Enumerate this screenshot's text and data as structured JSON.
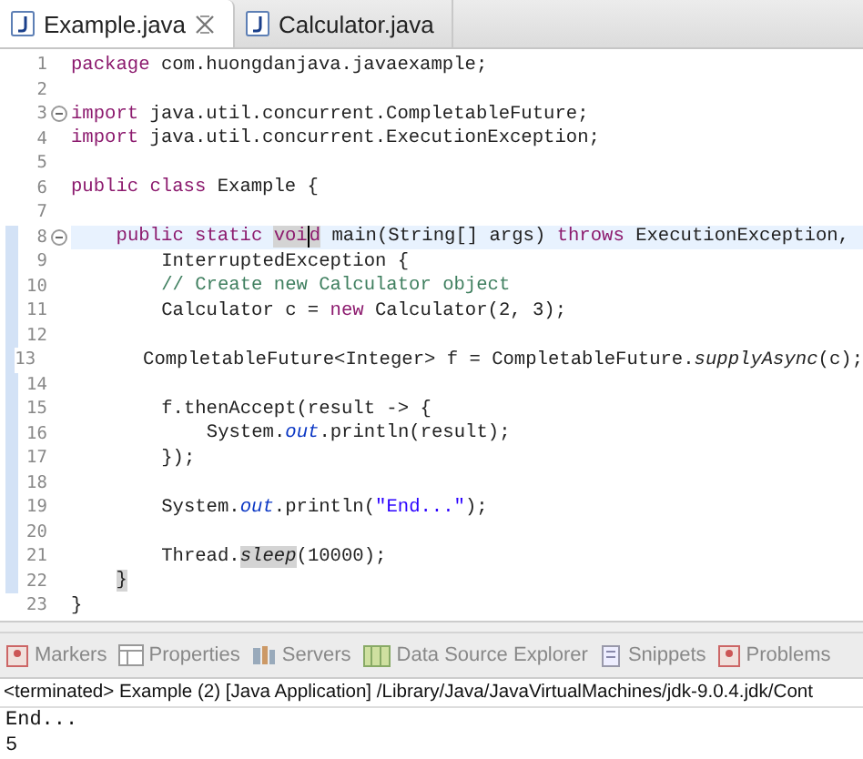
{
  "editor_tabs": [
    {
      "label": "Example.java",
      "selected": true,
      "closable": true
    },
    {
      "label": "Calculator.java",
      "selected": false,
      "closable": false
    }
  ],
  "code_lines": [
    {
      "number": "1",
      "kind": "top",
      "current": false,
      "in_range": false,
      "fold": false,
      "segments": [
        {
          "kind": "keyword",
          "text": "package ",
          "highlighted": false
        },
        {
          "kind": "plain",
          "text": "com.huongdanjava.javaexample;",
          "highlighted": false
        }
      ]
    },
    {
      "number": "2",
      "kind": "top",
      "current": false,
      "in_range": false,
      "fold": false
    },
    {
      "number": "3",
      "kind": "top",
      "current": false,
      "in_range": false,
      "fold": true,
      "segments": [
        {
          "kind": "keyword",
          "text": "import ",
          "highlighted": false
        },
        {
          "kind": "plain",
          "text": "java.util.concurrent.CompletableFuture;",
          "highlighted": false
        }
      ]
    },
    {
      "number": "4",
      "kind": "top",
      "current": false,
      "in_range": false,
      "fold": false,
      "segments": [
        {
          "kind": "keyword",
          "text": "import ",
          "highlighted": false
        },
        {
          "kind": "plain",
          "text": "java.util.concurrent.ExecutionException;",
          "highlighted": false
        }
      ]
    },
    {
      "number": "5",
      "kind": "top",
      "current": false,
      "in_range": false,
      "fold": false
    },
    {
      "number": "6",
      "kind": "top",
      "current": false,
      "in_range": false,
      "fold": false,
      "segments": [
        {
          "kind": "keyword",
          "text": "public class ",
          "highlighted": false
        },
        {
          "kind": "plain",
          "text": "Example {",
          "highlighted": false
        }
      ]
    },
    {
      "number": "7",
      "kind": "top",
      "current": false,
      "in_range": false,
      "fold": false
    },
    {
      "number": "8",
      "kind": "member",
      "current": true,
      "in_range": true,
      "fold": true,
      "segments": [
        {
          "kind": "keyword",
          "text": "public static ",
          "highlighted": false
        },
        {
          "kind": "keyword",
          "text": "voi",
          "highlighted": true
        },
        {
          "kind": "cursor"
        },
        {
          "kind": "keyword",
          "text": "d",
          "highlighted": true
        },
        {
          "kind": "plain",
          "text": " main(String[] args) ",
          "highlighted": false
        },
        {
          "kind": "keyword",
          "text": "throws ",
          "highlighted": false
        },
        {
          "kind": "plain",
          "text": "ExecutionException,",
          "highlighted": false
        }
      ]
    },
    {
      "number": "9",
      "kind": "body",
      "current": false,
      "in_range": true,
      "fold": false,
      "segments": [
        {
          "kind": "plain",
          "text": "InterruptedException {",
          "highlighted": false
        }
      ]
    },
    {
      "number": "10",
      "kind": "body",
      "current": false,
      "in_range": true,
      "fold": false,
      "segments": [
        {
          "kind": "comment",
          "text": "// Create new Calculator object",
          "highlighted": false
        }
      ]
    },
    {
      "number": "11",
      "kind": "body",
      "current": false,
      "in_range": true,
      "fold": false,
      "segments": [
        {
          "kind": "plain",
          "text": "Calculator c = ",
          "highlighted": false
        },
        {
          "kind": "keyword",
          "text": "new ",
          "highlighted": false
        },
        {
          "kind": "plain",
          "text": "Calculator(2, 3);",
          "highlighted": false
        }
      ]
    },
    {
      "number": "12",
      "kind": "body",
      "current": false,
      "in_range": true,
      "fold": false
    },
    {
      "number": "13",
      "kind": "body",
      "current": false,
      "in_range": true,
      "fold": false,
      "segments": [
        {
          "kind": "plain",
          "text": "CompletableFuture<Integer> f = CompletableFuture.",
          "highlighted": false
        },
        {
          "kind": "static",
          "text": "supplyAsync",
          "highlighted": false
        },
        {
          "kind": "plain",
          "text": "(c);",
          "highlighted": false
        }
      ]
    },
    {
      "number": "14",
      "kind": "body",
      "current": false,
      "in_range": true,
      "fold": false
    },
    {
      "number": "15",
      "kind": "body",
      "current": false,
      "in_range": true,
      "fold": false,
      "segments": [
        {
          "kind": "plain",
          "text": "f.thenAccept(result -> {",
          "highlighted": false
        }
      ]
    },
    {
      "number": "16",
      "kind": "inner",
      "current": false,
      "in_range": true,
      "fold": false,
      "segments": [
        {
          "kind": "plain",
          "text": "System.",
          "highlighted": false
        },
        {
          "kind": "field",
          "text": "out",
          "highlighted": false
        },
        {
          "kind": "plain",
          "text": ".println(result);",
          "highlighted": false
        }
      ]
    },
    {
      "number": "17",
      "kind": "body",
      "current": false,
      "in_range": true,
      "fold": false,
      "segments": [
        {
          "kind": "plain",
          "text": "});",
          "highlighted": false
        }
      ]
    },
    {
      "number": "18",
      "kind": "body",
      "current": false,
      "in_range": true,
      "fold": false
    },
    {
      "number": "19",
      "kind": "body",
      "current": false,
      "in_range": true,
      "fold": false,
      "segments": [
        {
          "kind": "plain",
          "text": "System.",
          "highlighted": false
        },
        {
          "kind": "field",
          "text": "out",
          "highlighted": false
        },
        {
          "kind": "plain",
          "text": ".println(",
          "highlighted": false
        },
        {
          "kind": "string",
          "text": "\"End...\"",
          "highlighted": false
        },
        {
          "kind": "plain",
          "text": ");",
          "highlighted": false
        }
      ]
    },
    {
      "number": "20",
      "kind": "body",
      "current": false,
      "in_range": true,
      "fold": false
    },
    {
      "number": "21",
      "kind": "body",
      "current": false,
      "in_range": true,
      "fold": false,
      "segments": [
        {
          "kind": "plain",
          "text": "Thread.",
          "highlighted": false
        },
        {
          "kind": "static",
          "text": "sleep",
          "highlighted": true
        },
        {
          "kind": "plain",
          "text": "(10000);",
          "highlighted": false
        }
      ]
    },
    {
      "number": "22",
      "kind": "member",
      "current": false,
      "in_range": true,
      "fold": false,
      "segments": [
        {
          "kind": "plain",
          "text": "}",
          "highlighted": true
        }
      ]
    },
    {
      "number": "23",
      "kind": "top",
      "current": false,
      "in_range": false,
      "fold": false,
      "segments": [
        {
          "kind": "plain",
          "text": "}",
          "highlighted": false
        }
      ]
    }
  ],
  "panel_tabs": [
    {
      "label": "Markers"
    },
    {
      "label": "Properties"
    },
    {
      "label": "Servers"
    },
    {
      "label": "Data Source Explorer"
    },
    {
      "label": "Snippets"
    },
    {
      "label": "Problems"
    }
  ],
  "console": {
    "header": "<terminated> Example (2) [Java Application] /Library/Java/JavaVirtualMachines/jdk-9.0.4.jdk/Cont",
    "output": [
      "End...",
      "5"
    ]
  }
}
